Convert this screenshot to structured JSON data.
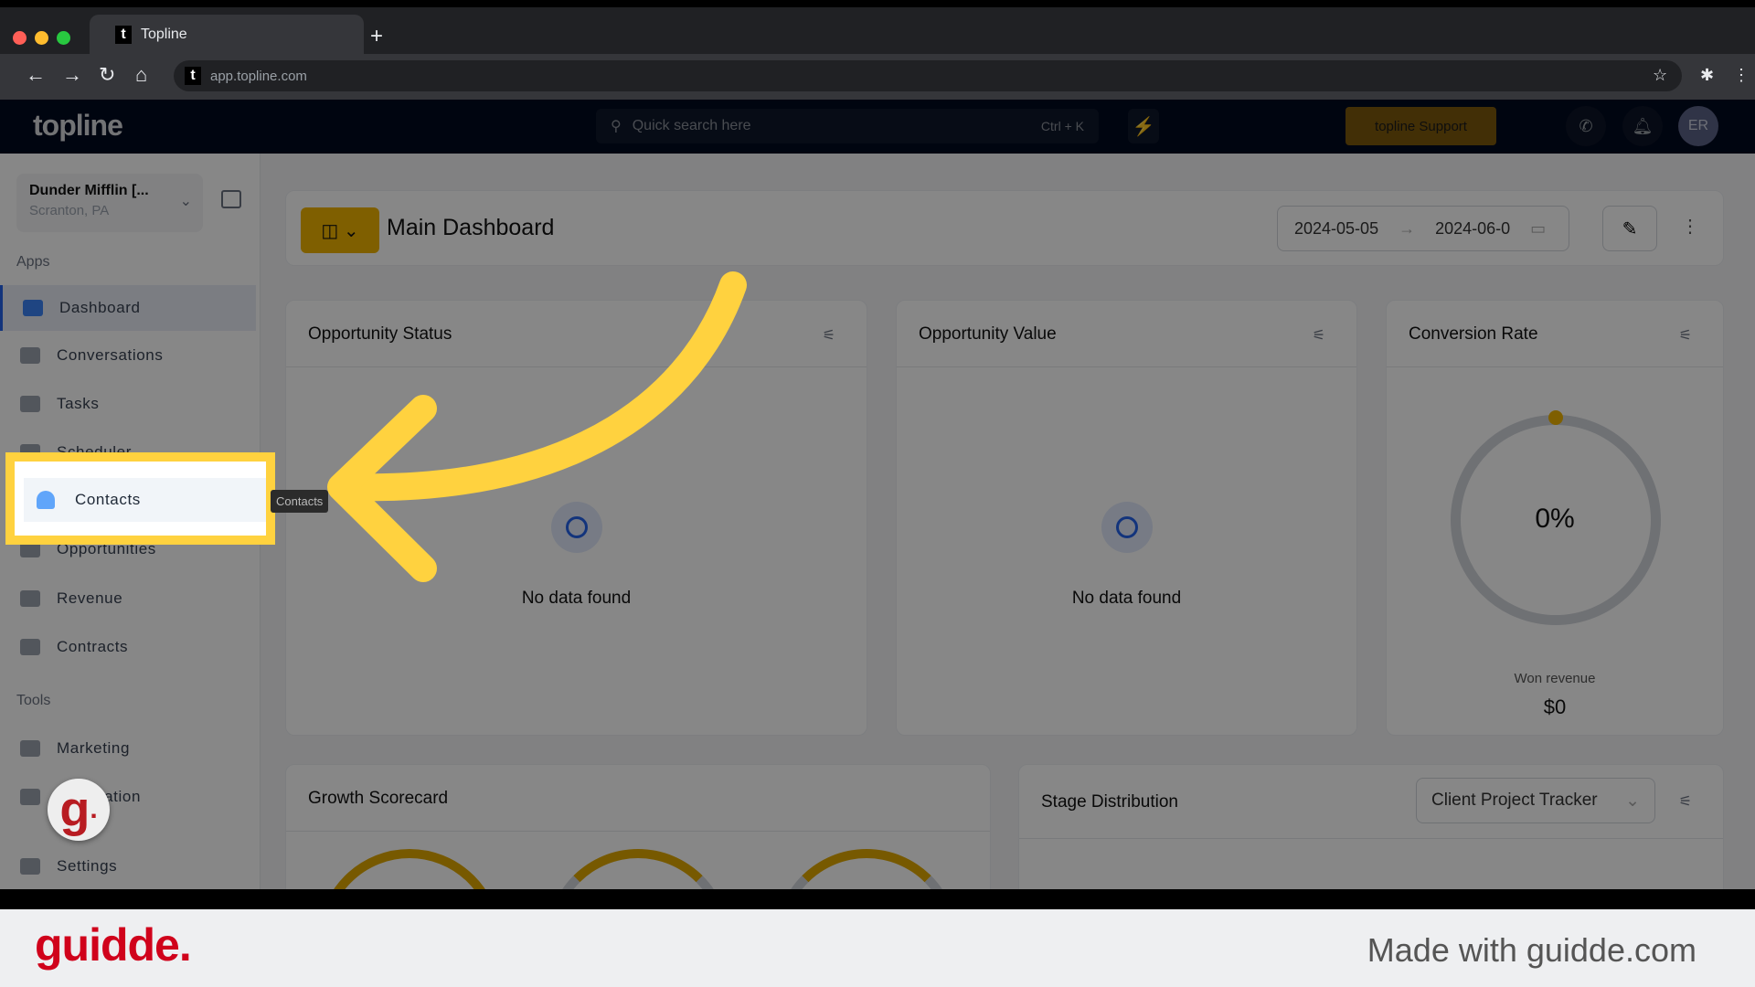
{
  "browser": {
    "tab_title": "Topline",
    "url": "app.topline.com",
    "favicon": "t"
  },
  "header": {
    "logo": "topline",
    "search_placeholder": "Quick search here",
    "search_shortcut": "Ctrl + K",
    "support_label": "topline Support",
    "avatar_initials": "ER",
    "accent": "#f0b400"
  },
  "sidebar": {
    "org_name": "Dunder Mifflin [...",
    "org_location": "Scranton, PA",
    "apps_label": "Apps",
    "apps": [
      {
        "label": "Dashboard",
        "active": true
      },
      {
        "label": "Conversations"
      },
      {
        "label": "Tasks"
      },
      {
        "label": "Scheduler"
      },
      {
        "label": "Contacts"
      },
      {
        "label": "Opportunities"
      },
      {
        "label": "Revenue"
      },
      {
        "label": "Contracts"
      }
    ],
    "tools_label": "Tools",
    "tools": [
      {
        "label": "Marketing"
      },
      {
        "label": "Automation"
      },
      {
        "label": "Settings"
      }
    ]
  },
  "highlight": {
    "label": "Contacts",
    "tooltip": "Contacts"
  },
  "dashboard": {
    "title": "Main Dashboard",
    "date_start": "2024-05-05",
    "date_end": "2024-06-0",
    "cards": {
      "opportunity_status": {
        "title": "Opportunity Status",
        "empty": "No data found"
      },
      "opportunity_value": {
        "title": "Opportunity Value",
        "empty": "No data found"
      },
      "conversion_rate": {
        "title": "Conversion Rate",
        "value": "0%",
        "won_label": "Won revenue",
        "won_value": "$0",
        "rate": 0
      },
      "growth_scorecard": {
        "title": "Growth Scorecard"
      },
      "stage_distribution": {
        "title": "Stage Distribution",
        "pipeline": "Client Project Tracker"
      }
    }
  },
  "footer": {
    "logo": "guidde.",
    "badge": "g.",
    "made_with": "Made with guidde.com"
  }
}
